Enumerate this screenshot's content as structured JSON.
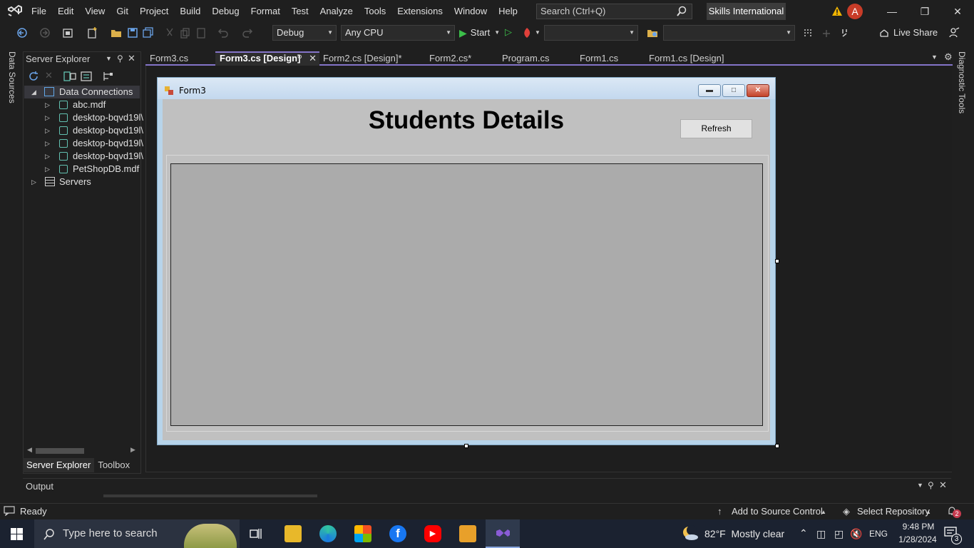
{
  "menubar": {
    "items": [
      "File",
      "Edit",
      "View",
      "Git",
      "Project",
      "Build",
      "Debug",
      "Format",
      "Test",
      "Analyze",
      "Tools",
      "Extensions",
      "Window",
      "Help"
    ],
    "search_placeholder": "Search (Ctrl+Q)",
    "profile": "Skills International",
    "avatar_letter": "A"
  },
  "toolbar": {
    "config": "Debug",
    "platform": "Any CPU",
    "start_label": "Start",
    "live_share": "Live Share"
  },
  "side_tabs": {
    "left": "Data Sources",
    "right": "Diagnostic Tools"
  },
  "server_explorer": {
    "title": "Server Explorer",
    "tree": [
      {
        "label": "Data Connections",
        "level": 0,
        "expanded": true
      },
      {
        "label": "abc.mdf",
        "level": 1
      },
      {
        "label": "desktop-bqvd19l\\",
        "level": 1
      },
      {
        "label": "desktop-bqvd19l\\",
        "level": 1
      },
      {
        "label": "desktop-bqvd19l\\",
        "level": 1
      },
      {
        "label": "desktop-bqvd19l\\",
        "level": 1
      },
      {
        "label": "PetShopDB.mdf",
        "level": 1
      },
      {
        "label": "Servers",
        "level": 0,
        "expanded": false
      }
    ],
    "bottom_tabs": [
      "Server Explorer",
      "Toolbox"
    ]
  },
  "doc_tabs": [
    {
      "label": "Form3.cs",
      "active": false
    },
    {
      "label": "Form3.cs [Design]",
      "active": true
    },
    {
      "label": "Form2.cs [Design]*",
      "active": false
    },
    {
      "label": "Form2.cs*",
      "active": false
    },
    {
      "label": "Program.cs",
      "active": false
    },
    {
      "label": "Form1.cs",
      "active": false
    },
    {
      "label": "Form1.cs [Design]",
      "active": false
    }
  ],
  "form": {
    "title": "Form3",
    "heading": "Students Details",
    "refresh_button": "Refresh"
  },
  "output": {
    "title": "Output"
  },
  "statusbar": {
    "ready": "Ready",
    "source_control": "Add to Source Control",
    "repository": "Select Repository",
    "notifications": "2"
  },
  "taskbar": {
    "search_placeholder": "Type here to search",
    "weather": "82°F  Mostly clear",
    "language": "ENG",
    "time": "9:48 PM",
    "date": "1/28/2024",
    "notification_count": "3"
  }
}
